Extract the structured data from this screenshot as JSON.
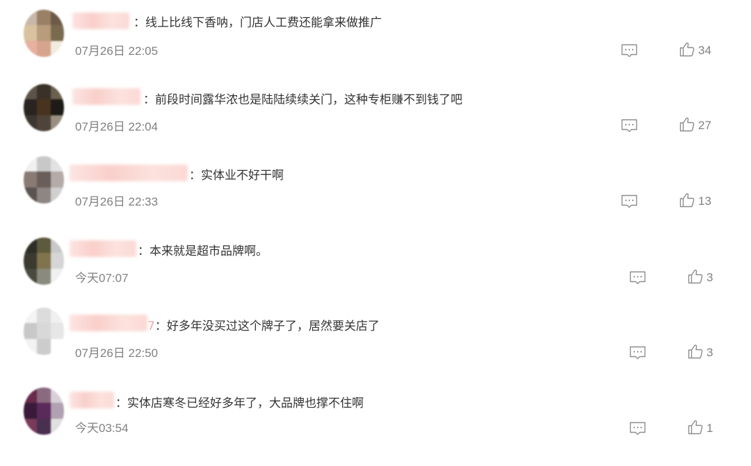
{
  "comments": [
    {
      "user_suffix": "",
      "text": "：线上比线下香呐，门店人工费还能拿来做推广",
      "time": "07月26日 22:05",
      "likes": "34",
      "avatar_colors": [
        "#c8b8a8",
        "#9a8064",
        "#6c5a48",
        "#d8c2a0",
        "#b89c7c",
        "#7a6a50",
        "#e8b0a0",
        "#d6a48c",
        "#f2ecde"
      ]
    },
    {
      "user_suffix": "",
      "text": "：前段时间露华浓也是陆陆续续关门，这种专柜赚不到钱了吧",
      "time": "07月26日 22:04",
      "likes": "27",
      "avatar_colors": [
        "#5c5448",
        "#3a3228",
        "#6a604e",
        "#2a2420",
        "#48341e",
        "#1e1a16",
        "#3c3630",
        "#4e443a",
        "#9a9080"
      ]
    },
    {
      "user_suffix": "",
      "text": "：实体业不好干啊",
      "time": "07月26日 22:33",
      "likes": "13",
      "avatar_colors": [
        "#f0f0f0",
        "#c8c8c8",
        "#e2e2e2",
        "#8a7a74",
        "#6a5e5a",
        "#b4aaa6",
        "#5c5450",
        "#8e8682",
        "#d0d0d0"
      ]
    },
    {
      "user_suffix": "",
      "text": "：本来就是超市品牌啊。",
      "time": "今天07:07",
      "likes": "3",
      "avatar_colors": [
        "#2e2e26",
        "#5e5a3e",
        "#c8c8c8",
        "#3a3a30",
        "#80744c",
        "#d6d6d6",
        "#4a4a40",
        "#8a8a7e",
        "#f0f0f0"
      ]
    },
    {
      "user_suffix": "7",
      "text": "：好多年没买过这个牌子了，居然要关店了",
      "time": "07月26日 22:50",
      "likes": "3",
      "avatar_colors": [
        "#f4f4f4",
        "#dcdcdc",
        "#f0f0f0",
        "#c8c8c8",
        "#d8d8d8",
        "#e6e6e6",
        "#f2f2f2",
        "#cccccc",
        "#ffffff"
      ]
    },
    {
      "user_suffix": "",
      "text": "：实体店寒冬已经好多年了，大品牌也撑不住啊",
      "time": "今天03:54",
      "likes": "1",
      "avatar_colors": [
        "#6a2a4a",
        "#8a6a80",
        "#d8d0d8",
        "#3a1a3a",
        "#5a2a5a",
        "#b0a0b0",
        "#7a3a5a",
        "#4a3050",
        "#e0e0e0"
      ]
    }
  ]
}
